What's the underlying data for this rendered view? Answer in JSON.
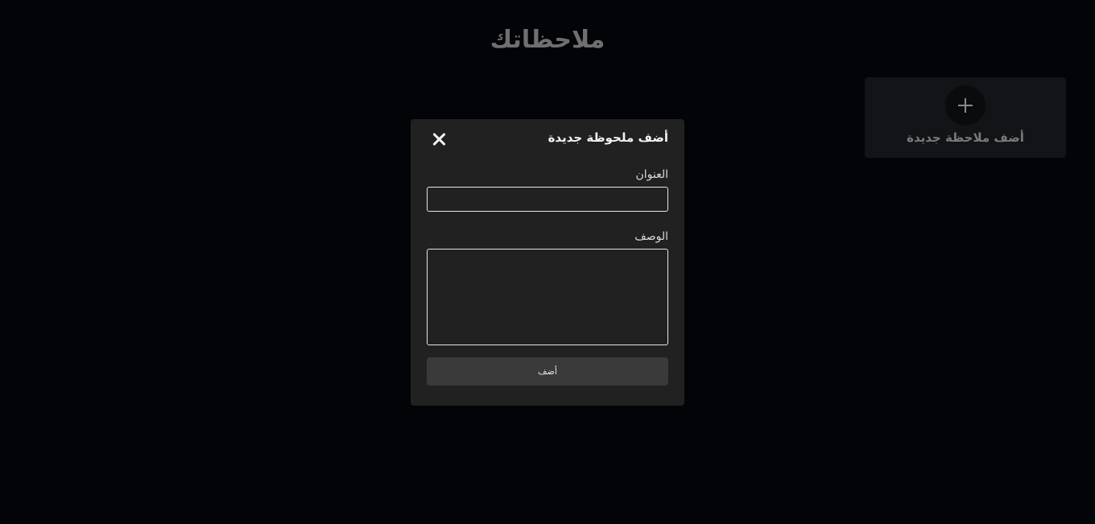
{
  "page": {
    "title": "ملاحظاتك"
  },
  "add_card": {
    "icon": "plus-icon",
    "label": "أضف ملاحظة جديدة"
  },
  "modal": {
    "title": "أضف ملحوظة جديدة",
    "close_icon": "close-icon",
    "title_field": {
      "label": "العنوان",
      "value": "",
      "placeholder": ""
    },
    "description_field": {
      "label": "الوصف",
      "value": "",
      "placeholder": ""
    },
    "submit_label": "أضف"
  }
}
